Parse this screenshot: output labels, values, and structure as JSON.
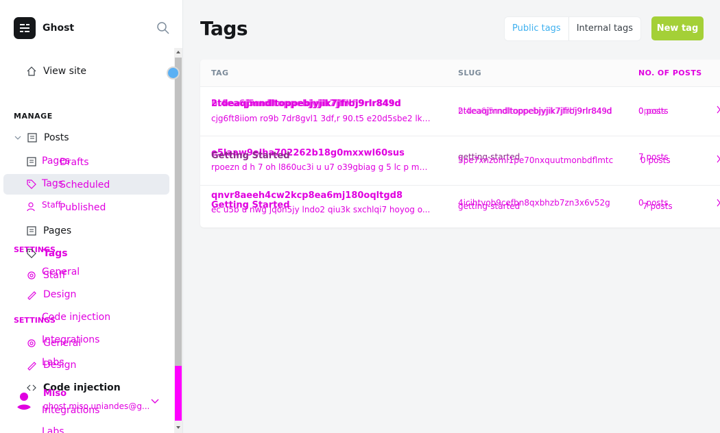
{
  "brand": {
    "name": "Ghost"
  },
  "sidebar": {
    "view_site": "View site",
    "manage_title": "MANAGE",
    "posts": "Posts",
    "posts_sub": [
      "Drafts",
      "Scheduled",
      "Published"
    ],
    "pages": "Pages",
    "tags": "Tags",
    "staff": "Staff",
    "settings_title": "SETTINGS",
    "settings_items": [
      "General",
      "Design",
      "Code injection",
      "Integrations",
      "Labs"
    ],
    "overlay_items": [
      "Pages",
      "Tags",
      "Staff"
    ],
    "overlay_settings_title": "SETTINGS",
    "overlay_settings_items": [
      "General",
      "Design",
      "Code injection",
      "Integrations"
    ],
    "user": {
      "name": "Miso",
      "email": "ghost.miso.uniandes@g..."
    }
  },
  "main": {
    "title": "Tags",
    "toggle": {
      "public": "Public tags",
      "internal": "Internal tags"
    },
    "new_tag": "New tag",
    "columns": {
      "tag": "TAG",
      "slug": "SLUG",
      "no_of_posts": "NO. OF POSTS"
    },
    "rows": [
      {
        "name": "2tdeaqjmndltoppebjyjik7jfrbj9rlr849d",
        "name_overlay": "bl4ea6j5mdltoppebjyjik7jlfkfj9rlr84sd",
        "description": "cjg6ft8iiom ro9b 7dr8gvl1 3df,r 90.t5 e20d5sbe2 lk o...",
        "slug": "2tdeaqjmndltoppebjyjik7jfrbj9rlr849d",
        "slug_overlay": "bl4ea6j5mdltoppebjyjik7jlfkfj9rlr84sd",
        "posts": "0 posts",
        "posts_overlay": "0posts"
      },
      {
        "name": "e5laaw9elha702262b18g0mxxwl60sus",
        "name_overlay": "Getting Started",
        "description": "rpoezn d h 7 oh l860uc3i u u7 o39gbiag g 5 lc p m8...",
        "slug": "getting-started",
        "slug_overlay": "5pe7xnzoml1pe70nxquutmonbdflmtc",
        "posts": "7 posts",
        "posts_overlay": "0 posts"
      },
      {
        "name": "qnvr8aeeh4cw2kcp8ea6mj180oqltgd8",
        "name_overlay": "Getting Started",
        "description": "ec u5b u nwg jqon5jy lndo2 qiu3k sxchlqi7 hoyog o...",
        "slug": "4icihtvob9cefbn8qxbhzb7zn3x6v52g",
        "slug_overlay": "getting-started",
        "posts": "0 posts",
        "posts_overlay": "7 posts"
      }
    ]
  },
  "colors": {
    "accent_green": "#a4d037",
    "overlay_magenta": "#e000e0",
    "link_blue": "#3eb0ef"
  }
}
